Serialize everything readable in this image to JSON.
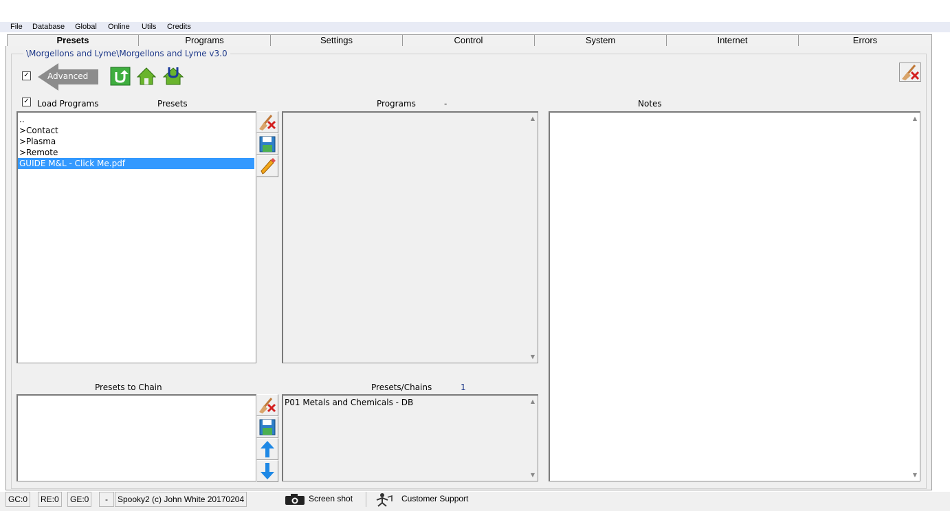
{
  "menu": [
    "File",
    "Database",
    "Global",
    "Online",
    "Utils",
    "Credits"
  ],
  "tabs": [
    "Presets",
    "Programs",
    "Settings",
    "Control",
    "System",
    "Internet",
    "Errors"
  ],
  "path": "\\Morgellons and Lyme\\Morgellons and Lyme v3.0",
  "toolbar": {
    "advanced_checked": "✓",
    "advanced_label": "Advanced",
    "icons": [
      "refresh-icon",
      "home-icon",
      "home-u-icon",
      "broom-icon"
    ]
  },
  "presets_panel": {
    "load_programs_checked": "✓",
    "load_programs_label": "Load Programs",
    "title": "Presets",
    "items": [
      "..",
      ">Contact",
      ">Plasma",
      ">Remote",
      "GUIDE M&L - Click Me.pdf"
    ],
    "selected_index": 4
  },
  "programs_panel": {
    "title": "Programs",
    "count": "-"
  },
  "notes_panel": {
    "title": "Notes"
  },
  "chain_panel": {
    "title": "Presets to Chain"
  },
  "presets_chains": {
    "title": "Presets/Chains",
    "count": "1",
    "items": [
      "P01 Metals and Chemicals - DB"
    ]
  },
  "status": {
    "gc": "GC:0",
    "re": "RE:0",
    "ge": "GE:0",
    "dash": "-",
    "copyright": "Spooky2 (c) John White 20170204",
    "screenshot": "Screen shot",
    "support": "Customer Support"
  }
}
